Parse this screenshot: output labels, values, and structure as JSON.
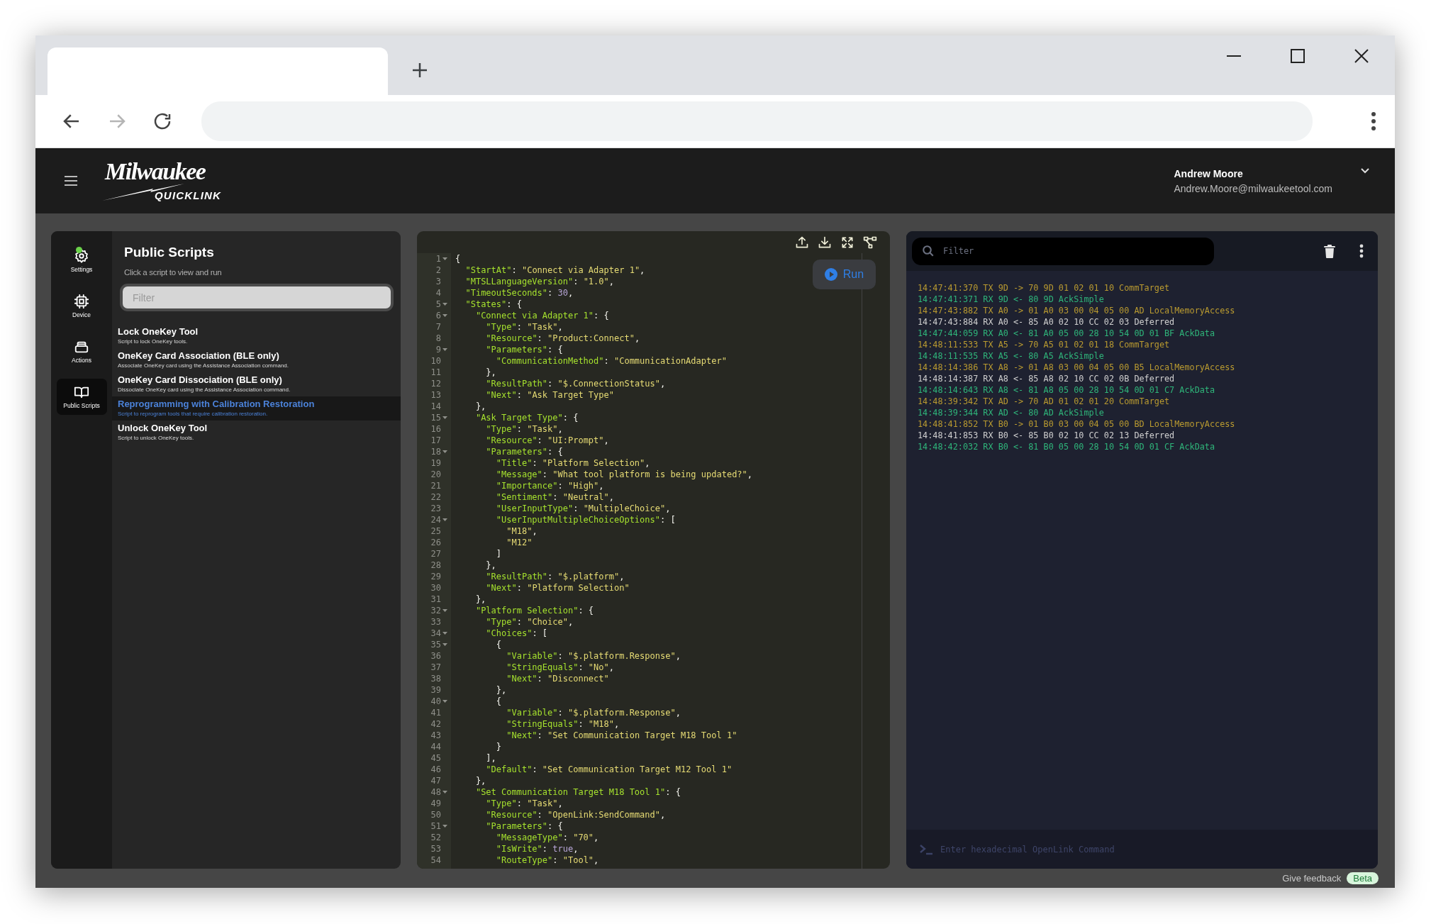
{
  "browser": {
    "nav_buttons": [
      {
        "kind": "back",
        "disabled": false
      },
      {
        "kind": "forward",
        "disabled": true
      },
      {
        "kind": "reload",
        "disabled": false
      }
    ]
  },
  "header": {
    "logo": "Milwaukee",
    "logo_sub": "QUICKLINK",
    "user_name": "Andrew Moore",
    "user_email": "Andrew.Moore@milwaukeetool.com"
  },
  "nav": [
    {
      "label": "Settings",
      "kind": "settings",
      "selected": false,
      "alert": true
    },
    {
      "label": "Device",
      "kind": "device",
      "selected": false,
      "alert": false
    },
    {
      "label": "Actions",
      "kind": "actions",
      "selected": false,
      "alert": false
    },
    {
      "label": "Public Scripts",
      "kind": "scripts",
      "selected": true,
      "alert": false
    }
  ],
  "scripts": {
    "title": "Public Scripts",
    "subtitle": "Click a script to view and run",
    "filter_placeholder": "Filter",
    "items": [
      {
        "title": "Lock OneKey Tool",
        "description": "Script to lock OneKey tools.",
        "selected": false
      },
      {
        "title": "OneKey Card Association (BLE only)",
        "description": "Associate OneKey card using the Assistance Association command.",
        "selected": false
      },
      {
        "title": "OneKey Card Dissociation (BLE only)",
        "description": "Dissociate OneKey card using the Assistance Association command.",
        "selected": false
      },
      {
        "title": "Reprogramming with Calibration Restoration",
        "description": "Script to reprogram tools that require calibration restoration.",
        "selected": true
      },
      {
        "title": "Unlock OneKey Tool",
        "description": "Script to unlock OneKey tools.",
        "selected": false
      }
    ]
  },
  "editor": {
    "run_label": "Run",
    "lines": [
      {
        "number": "1",
        "text": "{",
        "foldable": true
      },
      {
        "number": "2",
        "text": "  \"StartAt\": \"Connect via Adapter 1\",",
        "foldable": false
      },
      {
        "number": "3",
        "text": "  \"MTSLLanguageVersion\": \"1.0\",",
        "foldable": false
      },
      {
        "number": "4",
        "text": "  \"TimeoutSeconds\": 30,",
        "foldable": false
      },
      {
        "number": "5",
        "text": "  \"States\": {",
        "foldable": true
      },
      {
        "number": "6",
        "text": "    \"Connect via Adapter 1\": {",
        "foldable": true
      },
      {
        "number": "7",
        "text": "      \"Type\": \"Task\",",
        "foldable": false
      },
      {
        "number": "8",
        "text": "      \"Resource\": \"Product:Connect\",",
        "foldable": false
      },
      {
        "number": "9",
        "text": "      \"Parameters\": {",
        "foldable": true
      },
      {
        "number": "10",
        "text": "        \"CommunicationMethod\": \"CommunicationAdapter\"",
        "foldable": false
      },
      {
        "number": "11",
        "text": "      },",
        "foldable": false
      },
      {
        "number": "12",
        "text": "      \"ResultPath\": \"$.ConnectionStatus\",",
        "foldable": false
      },
      {
        "number": "13",
        "text": "      \"Next\": \"Ask Target Type\"",
        "foldable": false
      },
      {
        "number": "14",
        "text": "    },",
        "foldable": false
      },
      {
        "number": "15",
        "text": "    \"Ask Target Type\": {",
        "foldable": true
      },
      {
        "number": "16",
        "text": "      \"Type\": \"Task\",",
        "foldable": false
      },
      {
        "number": "17",
        "text": "      \"Resource\": \"UI:Prompt\",",
        "foldable": false
      },
      {
        "number": "18",
        "text": "      \"Parameters\": {",
        "foldable": true
      },
      {
        "number": "19",
        "text": "        \"Title\": \"Platform Selection\",",
        "foldable": false
      },
      {
        "number": "20",
        "text": "        \"Message\": \"What tool platform is being updated?\",",
        "foldable": false
      },
      {
        "number": "21",
        "text": "        \"Importance\": \"High\",",
        "foldable": false
      },
      {
        "number": "22",
        "text": "        \"Sentiment\": \"Neutral\",",
        "foldable": false
      },
      {
        "number": "23",
        "text": "        \"UserInputType\": \"MultipleChoice\",",
        "foldable": false
      },
      {
        "number": "24",
        "text": "        \"UserInputMultipleChoiceOptions\": [",
        "foldable": true
      },
      {
        "number": "25",
        "text": "          \"M18\",",
        "foldable": false
      },
      {
        "number": "26",
        "text": "          \"M12\"",
        "foldable": false
      },
      {
        "number": "27",
        "text": "        ]",
        "foldable": false
      },
      {
        "number": "28",
        "text": "      },",
        "foldable": false
      },
      {
        "number": "29",
        "text": "      \"ResultPath\": \"$.platform\",",
        "foldable": false
      },
      {
        "number": "30",
        "text": "      \"Next\": \"Platform Selection\"",
        "foldable": false
      },
      {
        "number": "31",
        "text": "    },",
        "foldable": false
      },
      {
        "number": "32",
        "text": "    \"Platform Selection\": {",
        "foldable": true
      },
      {
        "number": "33",
        "text": "      \"Type\": \"Choice\",",
        "foldable": false
      },
      {
        "number": "34",
        "text": "      \"Choices\": [",
        "foldable": true
      },
      {
        "number": "35",
        "text": "        {",
        "foldable": true
      },
      {
        "number": "36",
        "text": "          \"Variable\": \"$.platform.Response\",",
        "foldable": false
      },
      {
        "number": "37",
        "text": "          \"StringEquals\": \"No\",",
        "foldable": false
      },
      {
        "number": "38",
        "text": "          \"Next\": \"Disconnect\"",
        "foldable": false
      },
      {
        "number": "39",
        "text": "        },",
        "foldable": false
      },
      {
        "number": "40",
        "text": "        {",
        "foldable": true
      },
      {
        "number": "41",
        "text": "          \"Variable\": \"$.platform.Response\",",
        "foldable": false
      },
      {
        "number": "42",
        "text": "          \"StringEquals\": \"M18\",",
        "foldable": false
      },
      {
        "number": "43",
        "text": "          \"Next\": \"Set Communication Target M18 Tool 1\"",
        "foldable": false
      },
      {
        "number": "44",
        "text": "        }",
        "foldable": false
      },
      {
        "number": "45",
        "text": "      ],",
        "foldable": false
      },
      {
        "number": "46",
        "text": "      \"Default\": \"Set Communication Target M12 Tool 1\"",
        "foldable": false
      },
      {
        "number": "47",
        "text": "    },",
        "foldable": false
      },
      {
        "number": "48",
        "text": "    \"Set Communication Target M18 Tool 1\": {",
        "foldable": true
      },
      {
        "number": "49",
        "text": "      \"Type\": \"Task\",",
        "foldable": false
      },
      {
        "number": "50",
        "text": "      \"Resource\": \"OpenLink:SendCommand\",",
        "foldable": false
      },
      {
        "number": "51",
        "text": "      \"Parameters\": {",
        "foldable": true
      },
      {
        "number": "52",
        "text": "        \"MessageType\": \"70\",",
        "foldable": false
      },
      {
        "number": "53",
        "text": "        \"IsWrite\": true,",
        "foldable": false
      },
      {
        "number": "54",
        "text": "        \"RouteType\": \"Tool\",",
        "foldable": false
      }
    ]
  },
  "console": {
    "filter_placeholder": "Filter",
    "command_placeholder": "Enter hexadecimal OpenLink Command",
    "entries": [
      {
        "text": "14:47:41:370 TX 9D -> 70 9D 01 02 01 10 CommTarget",
        "kind": "tx"
      },
      {
        "text": "14:47:41:371 RX 9D <- 80 9D AckSimple",
        "kind": "ack"
      },
      {
        "text": "14:47:43:882 TX A0 -> 01 A0 03 00 04 05 00 AD LocalMemoryAccess",
        "kind": "tx"
      },
      {
        "text": "14:47:43:884 RX A0 <- 85 A0 02 10 CC 02 03 Deferred",
        "kind": "deferred"
      },
      {
        "text": "14:47:44:059 RX A0 <- 81 A0 05 00 28 10 54 0D 01 BF AckData",
        "kind": "ack"
      },
      {
        "text": "14:48:11:533 TX A5 -> 70 A5 01 02 01 18 CommTarget",
        "kind": "tx"
      },
      {
        "text": "14:48:11:535 RX A5 <- 80 A5 AckSimple",
        "kind": "ack"
      },
      {
        "text": "14:48:14:386 TX A8 -> 01 A8 03 00 04 05 00 B5 LocalMemoryAccess",
        "kind": "tx"
      },
      {
        "text": "14:48:14:387 RX A8 <- 85 A8 02 10 CC 02 0B Deferred",
        "kind": "deferred"
      },
      {
        "text": "14:48:14:643 RX A8 <- 81 A8 05 00 28 10 54 0D 01 C7 AckData",
        "kind": "ack"
      },
      {
        "text": "14:48:39:342 TX AD -> 70 AD 01 02 01 20 CommTarget",
        "kind": "tx"
      },
      {
        "text": "14:48:39:344 RX AD <- 80 AD AckSimple",
        "kind": "ack"
      },
      {
        "text": "14:48:41:852 TX B0 -> 01 B0 03 00 04 05 00 BD LocalMemoryAccess",
        "kind": "tx"
      },
      {
        "text": "14:48:41:853 RX B0 <- 85 B0 02 10 CC 02 13 Deferred",
        "kind": "deferred"
      },
      {
        "text": "14:48:42:032 RX B0 <- 81 B0 05 00 28 10 54 0D 01 CF AckData",
        "kind": "ack"
      }
    ]
  },
  "footer": {
    "feedback": "Give feedback",
    "badge": "Beta"
  }
}
